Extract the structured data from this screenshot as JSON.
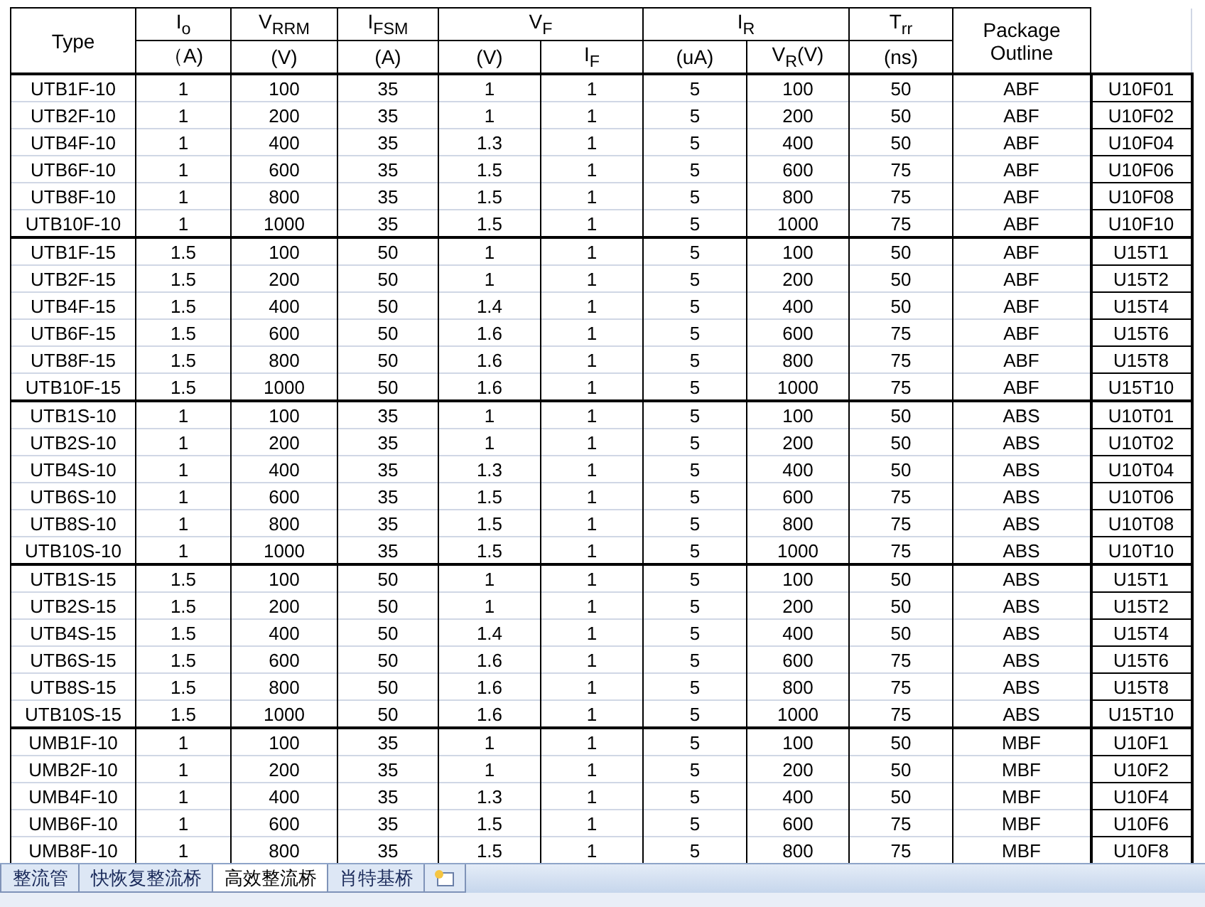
{
  "table": {
    "header_top": [
      {
        "text": "Type",
        "kind": "tall"
      },
      {
        "text": "I$_{o}$",
        "kind": "single"
      },
      {
        "text": "V$_{RRM}$",
        "kind": "single"
      },
      {
        "text": "I$_{FSM}$",
        "kind": "single"
      },
      {
        "text": "V$_{F}$",
        "kind": "group"
      },
      {
        "text": "I$_{R}$",
        "kind": "group"
      },
      {
        "text": "T$_{rr}$",
        "kind": "single"
      },
      {
        "text": "Package Outline",
        "kind": "tall"
      }
    ],
    "header_bottom": [
      "（A)",
      "(V)",
      "(A)",
      "(V)",
      "I$_{F}$",
      "(uA)",
      "V$_{R}$(V)",
      "(ns)"
    ],
    "groups": [
      {
        "rows": [
          [
            "UTB1F-10",
            "1",
            "100",
            "35",
            "1",
            "1",
            "5",
            "100",
            "50",
            "ABF",
            "U10F01"
          ],
          [
            "UTB2F-10",
            "1",
            "200",
            "35",
            "1",
            "1",
            "5",
            "200",
            "50",
            "ABF",
            "U10F02"
          ],
          [
            "UTB4F-10",
            "1",
            "400",
            "35",
            "1.3",
            "1",
            "5",
            "400",
            "50",
            "ABF",
            "U10F04"
          ],
          [
            "UTB6F-10",
            "1",
            "600",
            "35",
            "1.5",
            "1",
            "5",
            "600",
            "75",
            "ABF",
            "U10F06"
          ],
          [
            "UTB8F-10",
            "1",
            "800",
            "35",
            "1.5",
            "1",
            "5",
            "800",
            "75",
            "ABF",
            "U10F08"
          ],
          [
            "UTB10F-10",
            "1",
            "1000",
            "35",
            "1.5",
            "1",
            "5",
            "1000",
            "75",
            "ABF",
            "U10F10"
          ]
        ]
      },
      {
        "rows": [
          [
            "UTB1F-15",
            "1.5",
            "100",
            "50",
            "1",
            "1",
            "5",
            "100",
            "50",
            "ABF",
            "U15T1"
          ],
          [
            "UTB2F-15",
            "1.5",
            "200",
            "50",
            "1",
            "1",
            "5",
            "200",
            "50",
            "ABF",
            "U15T2"
          ],
          [
            "UTB4F-15",
            "1.5",
            "400",
            "50",
            "1.4",
            "1",
            "5",
            "400",
            "50",
            "ABF",
            "U15T4"
          ],
          [
            "UTB6F-15",
            "1.5",
            "600",
            "50",
            "1.6",
            "1",
            "5",
            "600",
            "75",
            "ABF",
            "U15T6"
          ],
          [
            "UTB8F-15",
            "1.5",
            "800",
            "50",
            "1.6",
            "1",
            "5",
            "800",
            "75",
            "ABF",
            "U15T8"
          ],
          [
            "UTB10F-15",
            "1.5",
            "1000",
            "50",
            "1.6",
            "1",
            "5",
            "1000",
            "75",
            "ABF",
            "U15T10"
          ]
        ]
      },
      {
        "rows": [
          [
            "UTB1S-10",
            "1",
            "100",
            "35",
            "1",
            "1",
            "5",
            "100",
            "50",
            "ABS",
            "U10T01"
          ],
          [
            "UTB2S-10",
            "1",
            "200",
            "35",
            "1",
            "1",
            "5",
            "200",
            "50",
            "ABS",
            "U10T02"
          ],
          [
            "UTB4S-10",
            "1",
            "400",
            "35",
            "1.3",
            "1",
            "5",
            "400",
            "50",
            "ABS",
            "U10T04"
          ],
          [
            "UTB6S-10",
            "1",
            "600",
            "35",
            "1.5",
            "1",
            "5",
            "600",
            "75",
            "ABS",
            "U10T06"
          ],
          [
            "UTB8S-10",
            "1",
            "800",
            "35",
            "1.5",
            "1",
            "5",
            "800",
            "75",
            "ABS",
            "U10T08"
          ],
          [
            "UTB10S-10",
            "1",
            "1000",
            "35",
            "1.5",
            "1",
            "5",
            "1000",
            "75",
            "ABS",
            "U10T10"
          ]
        ]
      },
      {
        "rows": [
          [
            "UTB1S-15",
            "1.5",
            "100",
            "50",
            "1",
            "1",
            "5",
            "100",
            "50",
            "ABS",
            "U15T1"
          ],
          [
            "UTB2S-15",
            "1.5",
            "200",
            "50",
            "1",
            "1",
            "5",
            "200",
            "50",
            "ABS",
            "U15T2"
          ],
          [
            "UTB4S-15",
            "1.5",
            "400",
            "50",
            "1.4",
            "1",
            "5",
            "400",
            "50",
            "ABS",
            "U15T4"
          ],
          [
            "UTB6S-15",
            "1.5",
            "600",
            "50",
            "1.6",
            "1",
            "5",
            "600",
            "75",
            "ABS",
            "U15T6"
          ],
          [
            "UTB8S-15",
            "1.5",
            "800",
            "50",
            "1.6",
            "1",
            "5",
            "800",
            "75",
            "ABS",
            "U15T8"
          ],
          [
            "UTB10S-15",
            "1.5",
            "1000",
            "50",
            "1.6",
            "1",
            "5",
            "1000",
            "75",
            "ABS",
            "U15T10"
          ]
        ]
      },
      {
        "rows": [
          [
            "UMB1F-10",
            "1",
            "100",
            "35",
            "1",
            "1",
            "5",
            "100",
            "50",
            "MBF",
            "U10F1"
          ],
          [
            "UMB2F-10",
            "1",
            "200",
            "35",
            "1",
            "1",
            "5",
            "200",
            "50",
            "MBF",
            "U10F2"
          ],
          [
            "UMB4F-10",
            "1",
            "400",
            "35",
            "1.3",
            "1",
            "5",
            "400",
            "50",
            "MBF",
            "U10F4"
          ],
          [
            "UMB6F-10",
            "1",
            "600",
            "35",
            "1.5",
            "1",
            "5",
            "600",
            "75",
            "MBF",
            "U10F6"
          ],
          [
            "UMB8F-10",
            "1",
            "800",
            "35",
            "1.5",
            "1",
            "5",
            "800",
            "75",
            "MBF",
            "U10F8"
          ]
        ]
      }
    ]
  },
  "sheet_tabs": [
    {
      "label": "整流管",
      "selected": false
    },
    {
      "label": "快恢复整流桥",
      "selected": false
    },
    {
      "label": "高效整流桥",
      "selected": true
    },
    {
      "label": "肖特基桥",
      "selected": false
    }
  ]
}
